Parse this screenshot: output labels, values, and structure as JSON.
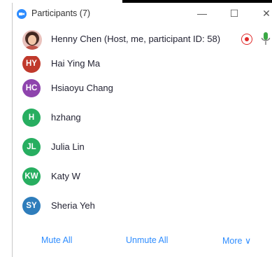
{
  "window": {
    "title": "Participants (7)"
  },
  "host": {
    "name": "Henny Chen (Host, me, participant ID: 58)"
  },
  "participants": [
    {
      "initials": "HY",
      "name": "Hai Ying Ma",
      "color": "#c0392b"
    },
    {
      "initials": "HC",
      "name": "Hsiaoyu Chang",
      "color": "#8e44ad"
    },
    {
      "initials": "H",
      "name": "hzhang",
      "color": "#27ae60"
    },
    {
      "initials": "JL",
      "name": "Julia Lin",
      "color": "#27ae60"
    },
    {
      "initials": "KW",
      "name": "Katy W",
      "color": "#27ae60"
    },
    {
      "initials": "SY",
      "name": "Sheria Yeh",
      "color": "#2e7dbb"
    }
  ],
  "footer": {
    "mute_all": "Mute All",
    "unmute_all": "Unmute All",
    "more": "More ∨"
  },
  "icons": {
    "app": "zoom-camera-icon",
    "record": "record-icon",
    "mic": "microphone-icon"
  },
  "colors": {
    "accent": "#2d8cff",
    "record": "#e02828",
    "mic": "#3aa845"
  }
}
